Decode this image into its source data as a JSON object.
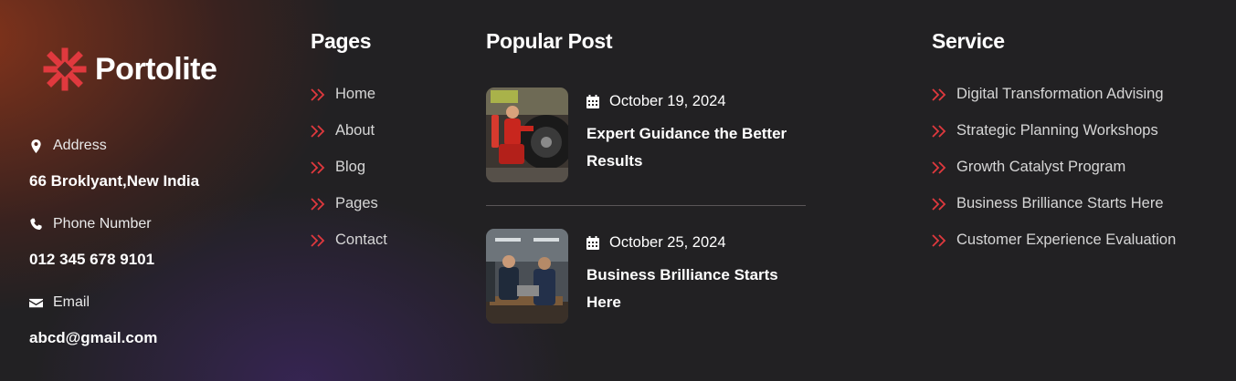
{
  "brand": {
    "name": "Portolite",
    "logo_icon": "asterisk-logo-icon",
    "accent_color": "#e0393e"
  },
  "contact": {
    "address_label": "Address",
    "address_value": "66 Broklyant,New India",
    "phone_label": "Phone Number",
    "phone_value": "012 345 678 9101",
    "email_label": "Email",
    "email_value": "abcd@gmail.com"
  },
  "pages": {
    "title": "Pages",
    "items": [
      "Home",
      "About",
      "Blog",
      "Pages",
      "Contact"
    ]
  },
  "popular_post": {
    "title": "Popular Post",
    "posts": [
      {
        "date": "October 19, 2024",
        "title": "Expert Guidance the Better Results",
        "image": "mechanic-tire-photo"
      },
      {
        "date": "October 25, 2024",
        "title": "Business Brilliance Starts Here",
        "image": "workshop-engineers-photo"
      }
    ]
  },
  "service": {
    "title": "Service",
    "items": [
      "Digital Transformation Advising",
      "Strategic Planning Workshops",
      "Growth Catalyst Program",
      "Business Brilliance Starts Here",
      "Customer Experience Evaluation"
    ]
  }
}
